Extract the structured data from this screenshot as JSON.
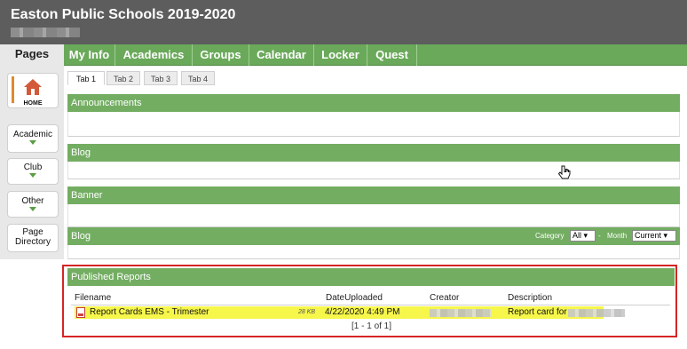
{
  "header": {
    "title": "Easton Public Schools 2019-2020"
  },
  "sidebar": {
    "pages_label": "Pages",
    "home_label": "HOME",
    "items": [
      {
        "label": "Academic"
      },
      {
        "label": "Club"
      },
      {
        "label": "Other"
      },
      {
        "label_line1": "Page",
        "label_line2": "Directory"
      }
    ]
  },
  "nav": {
    "tabs": [
      "My Info",
      "Academics",
      "Groups",
      "Calendar",
      "Locker",
      "Quest"
    ]
  },
  "subtabs": [
    "Tab 1",
    "Tab 2",
    "Tab 3",
    "Tab 4"
  ],
  "sections": [
    {
      "title": "Announcements"
    },
    {
      "title": "Blog"
    },
    {
      "title": "Banner"
    },
    {
      "title": "Blog",
      "category_label": "Category",
      "category_value": "All",
      "month_label": "Month",
      "month_value": "Current"
    }
  ],
  "reports": {
    "title": "Published Reports",
    "columns": [
      "Filename",
      "DateUploaded",
      "Creator",
      "Description"
    ],
    "rows": [
      {
        "filename": "Report Cards EMS - Trimester",
        "size": "28 KB",
        "date": "4/22/2020 4:49 PM",
        "description": "Report card for"
      }
    ],
    "pager": "[1 - 1 of 1]"
  },
  "colors": {
    "nav_green": "#6aa95a",
    "header_gray": "#5d5d5d",
    "highlight": "#f6f64b",
    "annotation_red": "#d52525"
  }
}
